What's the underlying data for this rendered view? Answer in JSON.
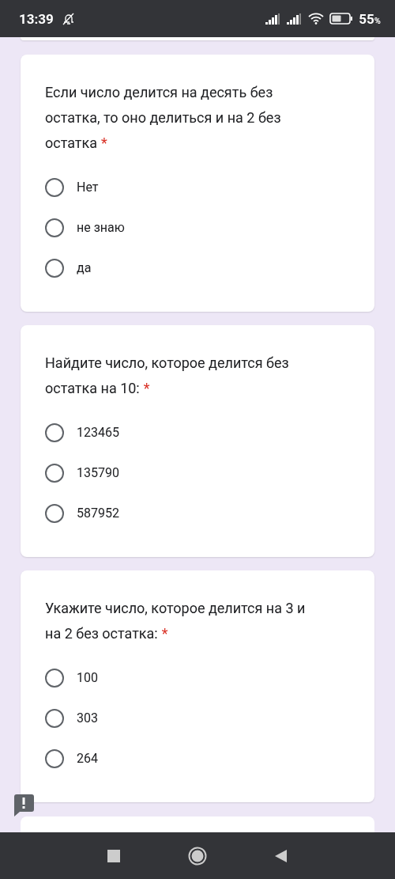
{
  "status_bar": {
    "time": "13:39",
    "battery": "55",
    "battery_unit": "%"
  },
  "questions": [
    {
      "text": "Если число делится на десять без остатка, то оно делиться и на 2 без остатка",
      "required_mark": "*",
      "options": [
        {
          "label": "Нет",
          "selected": false
        },
        {
          "label": "не знаю",
          "selected": false
        },
        {
          "label": "да",
          "selected": false
        }
      ]
    },
    {
      "text": "Найдите число, которое делится без остатка на 10:",
      "required_mark": "*",
      "options": [
        {
          "label": "123465",
          "selected": false
        },
        {
          "label": "135790",
          "selected": false
        },
        {
          "label": "587952",
          "selected": false
        }
      ]
    },
    {
      "text": "Укажите число, которое делится на 3 и на 2 без остатка:",
      "required_mark": "*",
      "options": [
        {
          "label": "100",
          "selected": false
        },
        {
          "label": "303",
          "selected": false
        },
        {
          "label": "264",
          "selected": false
        }
      ]
    }
  ]
}
